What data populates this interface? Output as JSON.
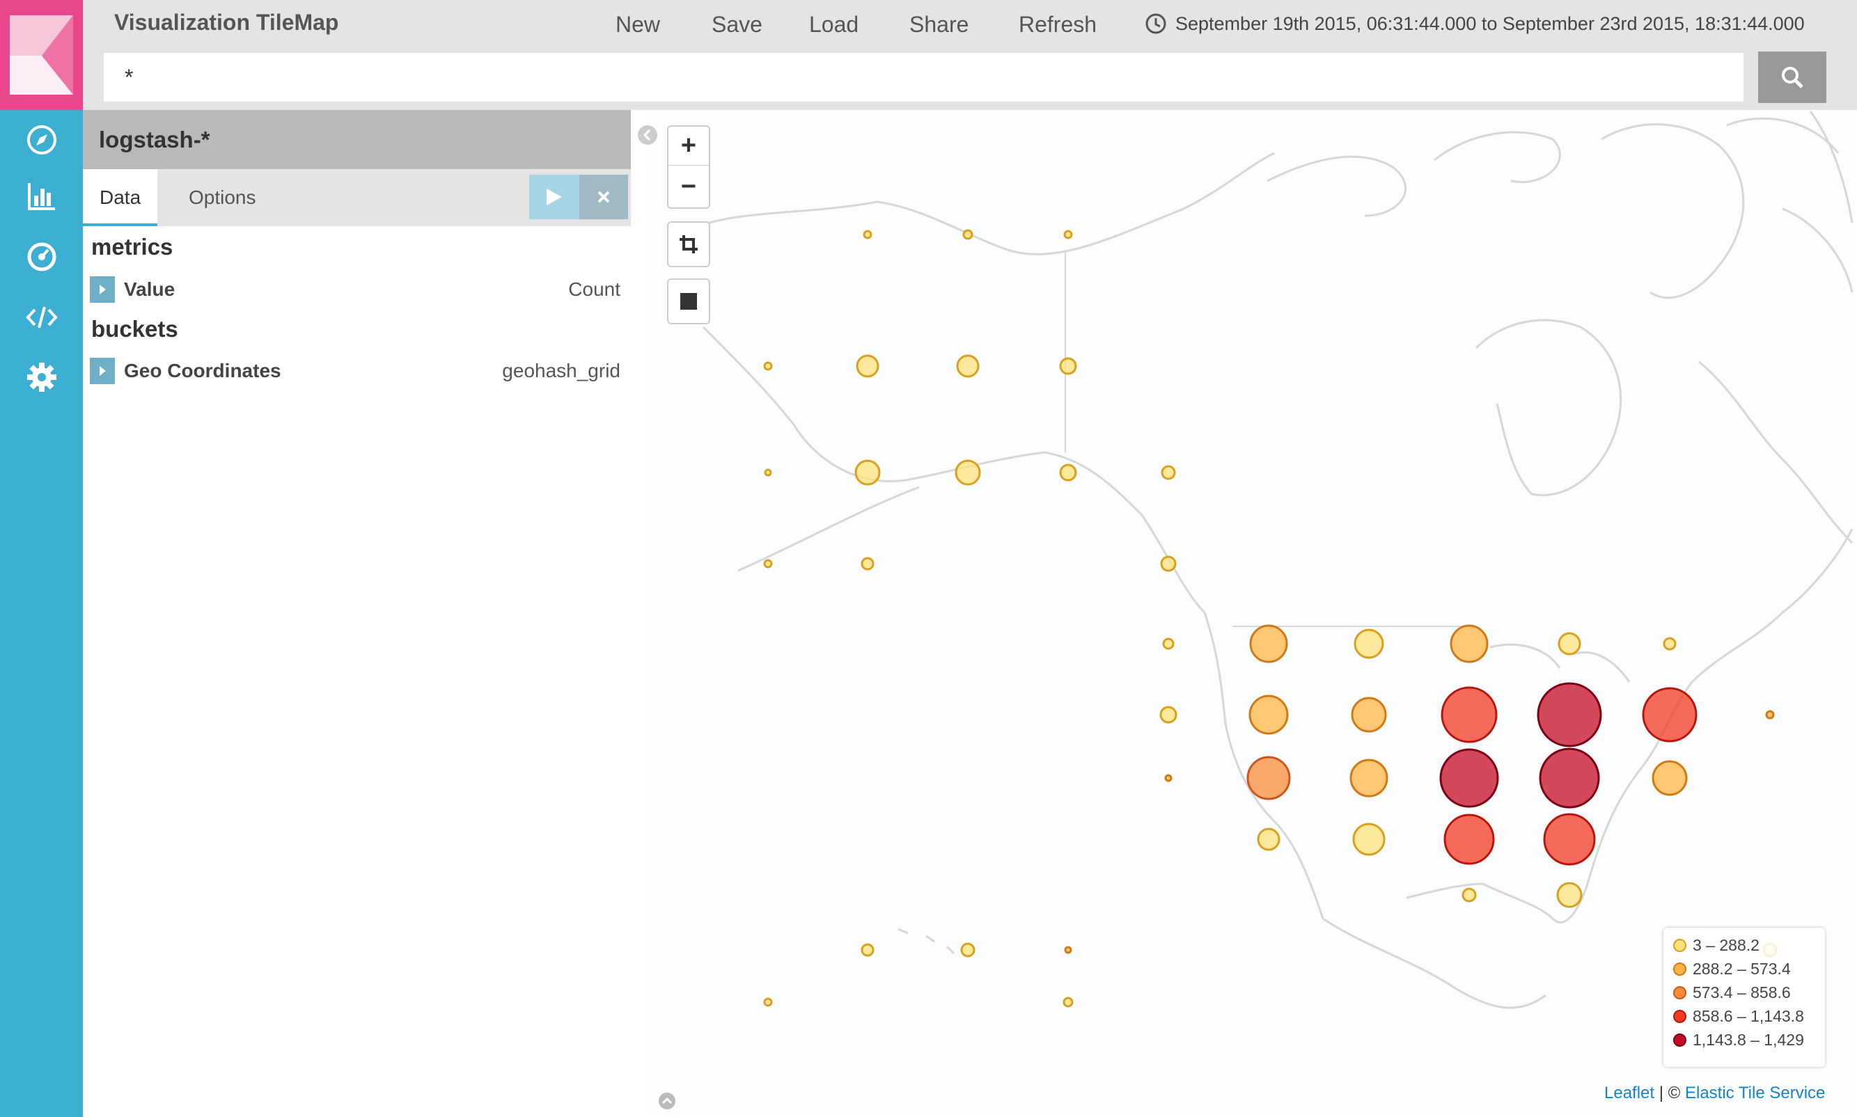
{
  "nav": {
    "items": [
      {
        "name": "discover",
        "icon": "compass-icon"
      },
      {
        "name": "visualize",
        "icon": "bar-chart-icon"
      },
      {
        "name": "dashboard",
        "icon": "dashboard-icon"
      },
      {
        "name": "dev-tools",
        "icon": "code-icon"
      },
      {
        "name": "settings",
        "icon": "gear-icon"
      }
    ],
    "colors": {
      "nav": "#3caed2",
      "logo": "#e8488b"
    }
  },
  "header": {
    "title": "Visualization TileMap",
    "menu": {
      "new": "New",
      "save": "Save",
      "load": "Load",
      "share": "Share",
      "refresh": "Refresh"
    },
    "time_range": "September 19th 2015, 06:31:44.000 to September 23rd 2015, 18:31:44.000",
    "time_icon": "clock-icon"
  },
  "search": {
    "query": "*",
    "button_icon": "search-icon"
  },
  "sidebar": {
    "index_pattern": "logstash-*",
    "tabs": {
      "data": "Data",
      "options": "Options"
    },
    "metrics_title": "metrics",
    "buckets_title": "buckets",
    "metric": {
      "label": "Value",
      "value": "Count"
    },
    "bucket": {
      "label": "Geo Coordinates",
      "value": "geohash_grid"
    }
  },
  "map": {
    "controls": {
      "zoom_in": "+",
      "zoom_out": "−"
    },
    "legend": [
      {
        "label": "3 – 288.2",
        "color": "#fee17a",
        "border": "#d99f1e"
      },
      {
        "label": "288.2 – 573.4",
        "color": "#fdb445",
        "border": "#d07a14"
      },
      {
        "label": "573.4 – 858.6",
        "color": "#fb8b3c",
        "border": "#c9571a"
      },
      {
        "label": "858.6 – 1,143.8",
        "color": "#f23b22",
        "border": "#b8160d"
      },
      {
        "label": "1,143.8 – 1,429",
        "color": "#c40c26",
        "border": "#7d0015"
      }
    ],
    "attribution": {
      "leaflet": "Leaflet",
      "separator": " | © ",
      "service": "Elastic Tile Service"
    }
  }
}
